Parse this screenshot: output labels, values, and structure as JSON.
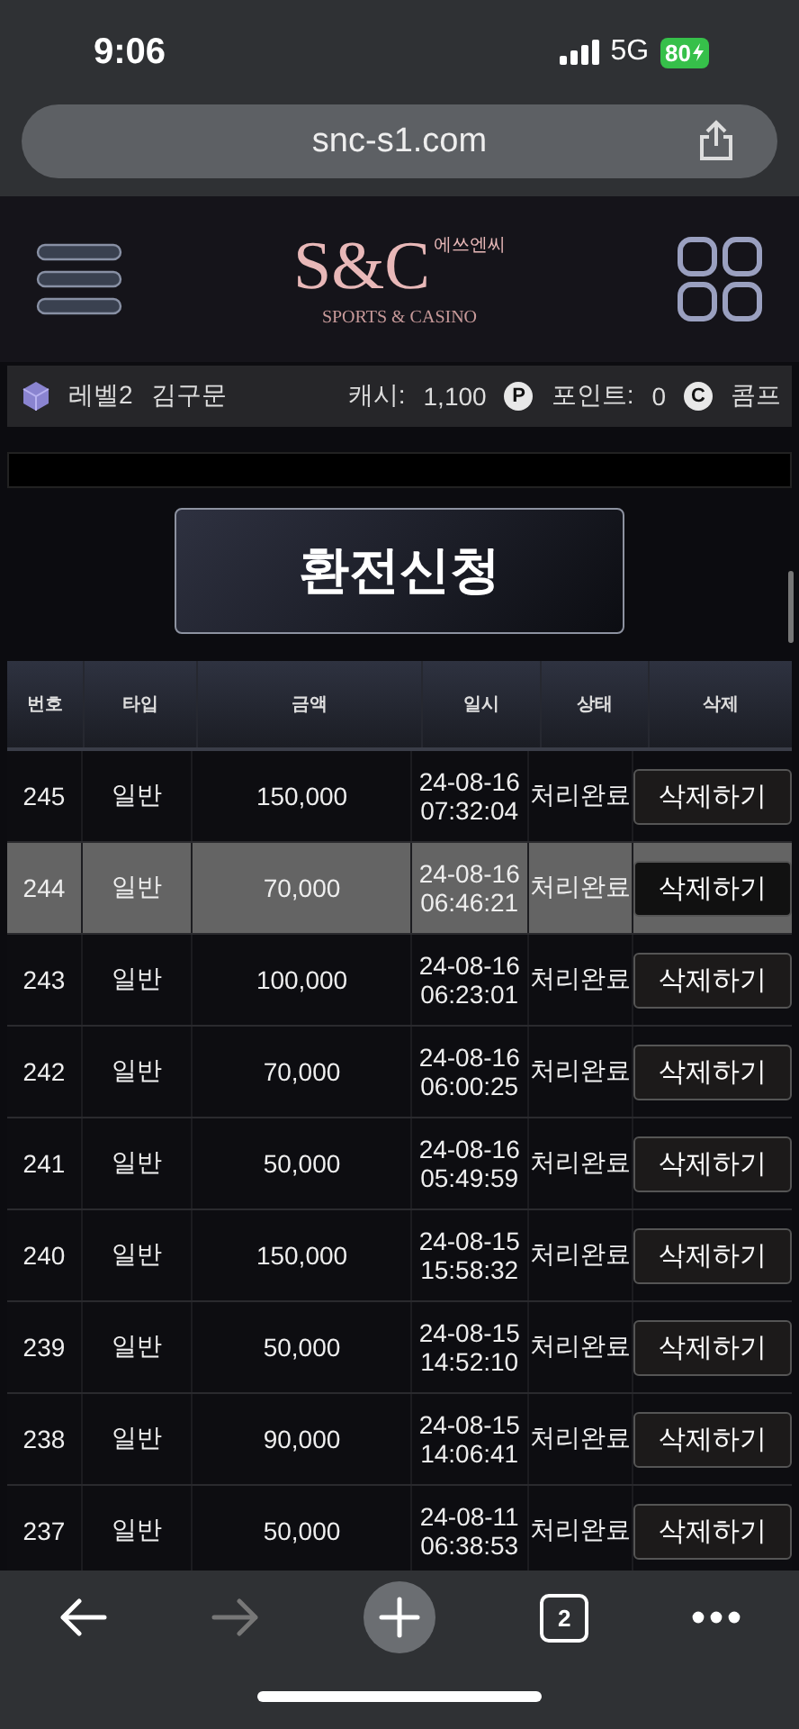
{
  "status_bar": {
    "time": "9:06",
    "network": "5G",
    "battery": "80"
  },
  "browser": {
    "url": "snc-s1.com",
    "tab_count": "2"
  },
  "logo": {
    "korean": "에쓰엔씨",
    "mark": "S&C",
    "tagline": "SPORTS & CASINO"
  },
  "user_bar": {
    "level": "레벨2",
    "name": "김구문",
    "cash_label": "캐시:",
    "cash": "1,100",
    "point_badge": "P",
    "points_label": "포인트:",
    "points": "0",
    "comp_badge": "C",
    "comp_label": "콤프"
  },
  "action_button": "환전신청",
  "table": {
    "columns": [
      "번호",
      "타입",
      "금액",
      "일시",
      "상태",
      "삭제"
    ],
    "rows": [
      {
        "no": "245",
        "type": "일반",
        "amount": "150,000",
        "date": "24-08-16",
        "time": "07:32:04",
        "status": "처리완료",
        "action": "삭제하기",
        "selected": false
      },
      {
        "no": "244",
        "type": "일반",
        "amount": "70,000",
        "date": "24-08-16",
        "time": "06:46:21",
        "status": "처리완료",
        "action": "삭제하기",
        "selected": true
      },
      {
        "no": "243",
        "type": "일반",
        "amount": "100,000",
        "date": "24-08-16",
        "time": "06:23:01",
        "status": "처리완료",
        "action": "삭제하기",
        "selected": false
      },
      {
        "no": "242",
        "type": "일반",
        "amount": "70,000",
        "date": "24-08-16",
        "time": "06:00:25",
        "status": "처리완료",
        "action": "삭제하기",
        "selected": false
      },
      {
        "no": "241",
        "type": "일반",
        "amount": "50,000",
        "date": "24-08-16",
        "time": "05:49:59",
        "status": "처리완료",
        "action": "삭제하기",
        "selected": false
      },
      {
        "no": "240",
        "type": "일반",
        "amount": "150,000",
        "date": "24-08-15",
        "time": "15:58:32",
        "status": "처리완료",
        "action": "삭제하기",
        "selected": false
      },
      {
        "no": "239",
        "type": "일반",
        "amount": "50,000",
        "date": "24-08-15",
        "time": "14:52:10",
        "status": "처리완료",
        "action": "삭제하기",
        "selected": false
      },
      {
        "no": "238",
        "type": "일반",
        "amount": "90,000",
        "date": "24-08-15",
        "time": "14:06:41",
        "status": "처리완료",
        "action": "삭제하기",
        "selected": false
      },
      {
        "no": "237",
        "type": "일반",
        "amount": "50,000",
        "date": "24-08-11",
        "time": "06:38:53",
        "status": "처리완료",
        "action": "삭제하기",
        "selected": false
      }
    ]
  }
}
